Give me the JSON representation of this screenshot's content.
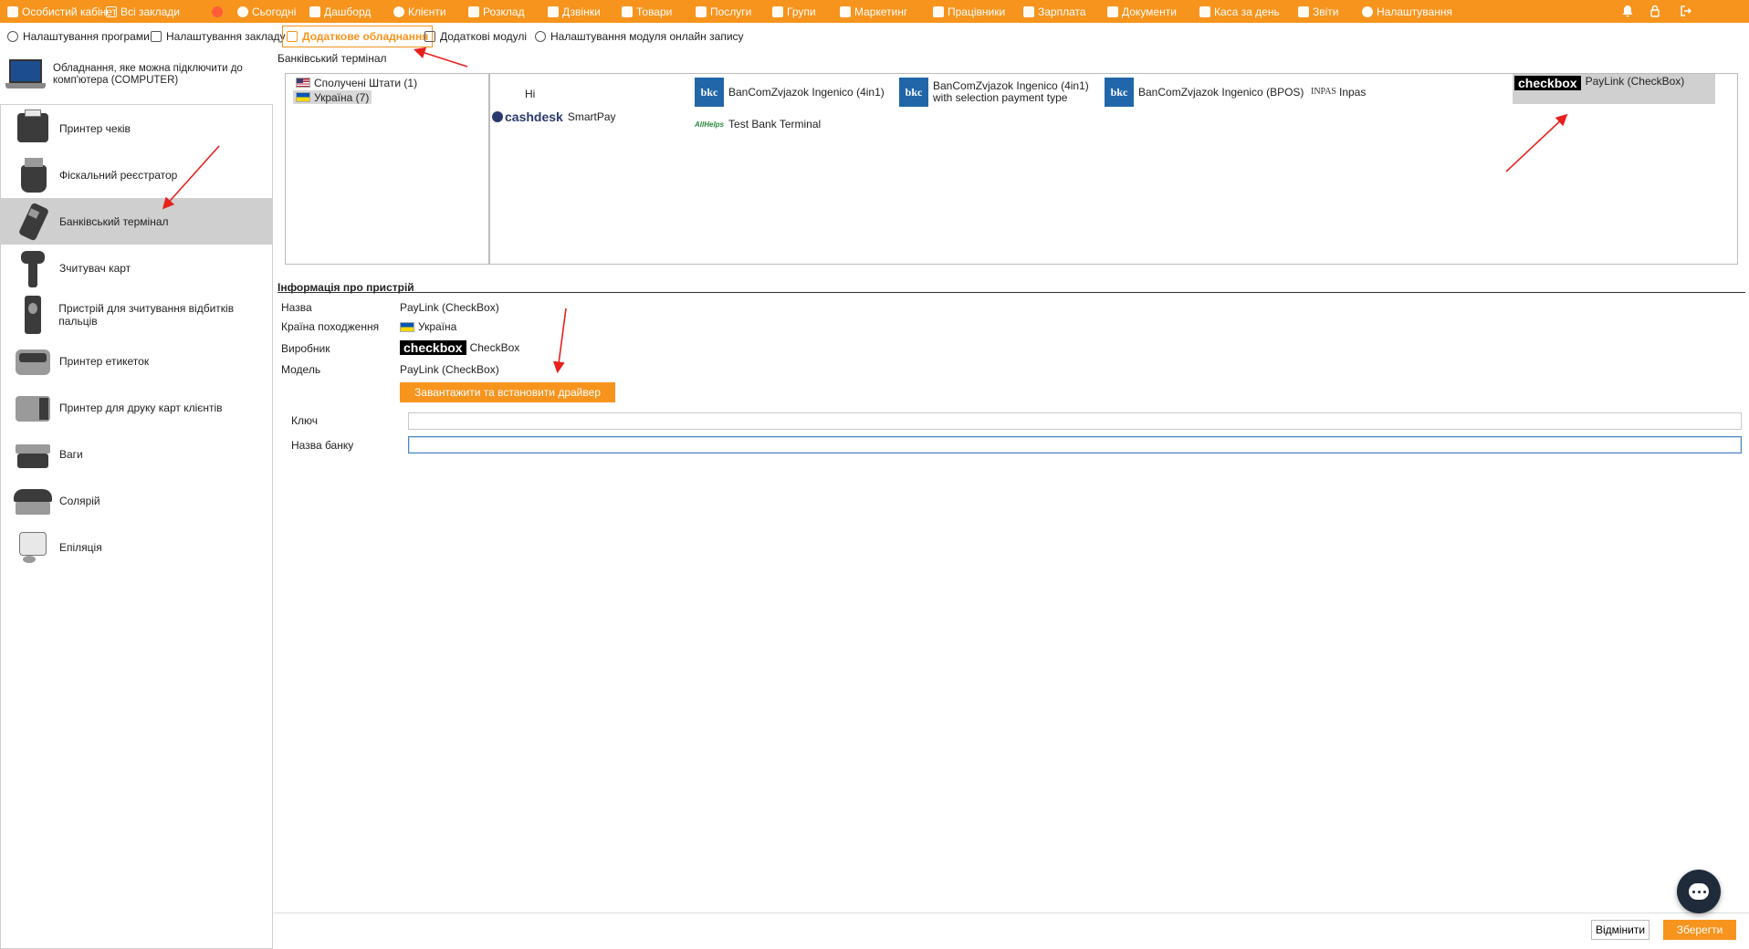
{
  "topnav": {
    "items": [
      {
        "label": "Особистий кабінет",
        "icon": "briefcase-icon"
      },
      {
        "label": "Всі заклади",
        "icon": "buildings-icon"
      },
      {
        "label": "",
        "icon": "phone-icon"
      },
      {
        "label": "Сьогодні",
        "icon": "clock-icon"
      },
      {
        "label": "Дашборд",
        "icon": "pulse-icon"
      },
      {
        "label": "Клієнти",
        "icon": "user-icon"
      },
      {
        "label": "Розклад",
        "icon": "calendar-icon"
      },
      {
        "label": "Дзвінки",
        "icon": "phone-book-icon"
      },
      {
        "label": "Товари",
        "icon": "box-icon"
      },
      {
        "label": "Послуги",
        "icon": "bolt-icon"
      },
      {
        "label": "Групи",
        "icon": "group-icon"
      },
      {
        "label": "Маркетинг",
        "icon": "megaphone-icon"
      },
      {
        "label": "Працівники",
        "icon": "worker-icon"
      },
      {
        "label": "Зарплата",
        "icon": "money-icon"
      },
      {
        "label": "Документи",
        "icon": "document-icon"
      },
      {
        "label": "Каса за день",
        "icon": "calculator-icon"
      },
      {
        "label": "Звіти",
        "icon": "bar-chart-icon"
      },
      {
        "label": "Налаштування",
        "icon": "gear-icon"
      }
    ],
    "active": "Налаштування"
  },
  "subtabs": {
    "items": [
      {
        "label": "Налаштування програми",
        "icon": "gear-icon"
      },
      {
        "label": "Налаштування закладу",
        "icon": "building-icon"
      },
      {
        "label": "Додаткове обладнання",
        "icon": "printer-icon"
      },
      {
        "label": "Додаткові модулі",
        "icon": "modules-icon"
      },
      {
        "label": "Налаштування модуля онлайн запису",
        "icon": "globe-icon"
      }
    ],
    "active": "Додаткове обладнання"
  },
  "sidebar": {
    "computer_label": "Обладнання, яке можна підключити до комп'ютера (COMPUTER)",
    "devices": [
      {
        "label": "Принтер чеків"
      },
      {
        "label": "Фіскальний реєстратор"
      },
      {
        "label": "Банківський термінал"
      },
      {
        "label": "Зчитувач карт"
      },
      {
        "label": "Пристрій для зчитування відбитків пальців"
      },
      {
        "label": "Принтер етикеток"
      },
      {
        "label": "Принтер для друку карт клієнтів"
      },
      {
        "label": "Ваги"
      },
      {
        "label": "Солярій"
      },
      {
        "label": "Епіляція"
      }
    ],
    "selected": "Банківський термінал"
  },
  "terminal_section": {
    "title": "Банківський термінал",
    "countries": [
      {
        "label": "Сполучені Штати (1)",
        "flag": "us"
      },
      {
        "label": "Україна (7)",
        "flag": "ua"
      }
    ],
    "selected_country": "Україна (7)",
    "terminals": [
      {
        "label": "Hi",
        "logo": ""
      },
      {
        "label": "BanComZvjazok Ingenico (4in1)",
        "logo": "bkc"
      },
      {
        "label": "BanComZvjazok Ingenico (4in1) with selection payment type",
        "logo": "bkc"
      },
      {
        "label": "BanComZvjazok Ingenico (BPOS)",
        "logo": "bkc"
      },
      {
        "label": "Inpas",
        "logo": "INPAS"
      },
      {
        "label": "PayLink (CheckBox)",
        "logo": "checkbox"
      },
      {
        "label": "SmartPay",
        "logo": "cashdesk"
      },
      {
        "label": "Test Bank Terminal",
        "logo": "AllHelps"
      }
    ],
    "selected_terminal": "PayLink (CheckBox)"
  },
  "info": {
    "title": "Інформація про пристрій",
    "rows": [
      {
        "label": "Назва",
        "value": "PayLink (CheckBox)"
      },
      {
        "label": "Країна походження",
        "value": "Україна"
      },
      {
        "label": "Виробник",
        "value": "CheckBox"
      },
      {
        "label": "Модель",
        "value": "PayLink (CheckBox)"
      }
    ],
    "driver_button": "Завантажити та встановити драйвер"
  },
  "form": {
    "key_label": "Ключ",
    "key_value": "",
    "bank_label": "Назва банку",
    "bank_value": ""
  },
  "logos": {
    "bkc": "bkc",
    "checkbox": "checkbox",
    "cashdesk": "cashdesk",
    "allhelps": "AllHelps",
    "inpas": "INPAS"
  },
  "footer": {
    "cancel": "Відмінити",
    "save": "Зберегти"
  },
  "colors": {
    "accent": "#f7941d",
    "selected_bg": "#cfcfcf",
    "annotation_arrow": "#e8201c"
  }
}
